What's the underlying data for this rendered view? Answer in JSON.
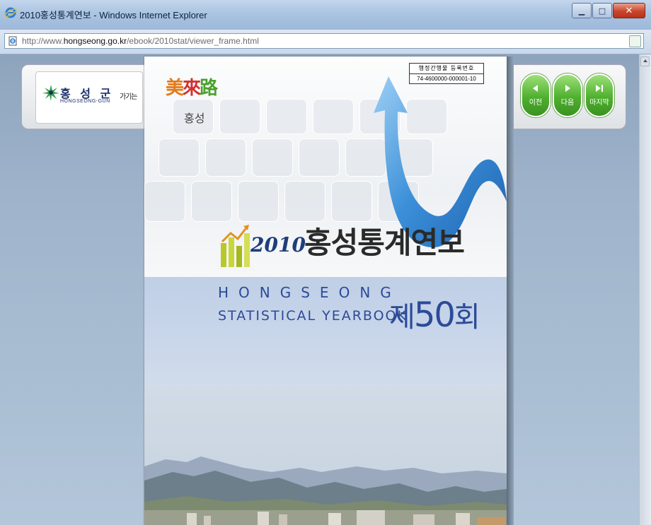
{
  "window": {
    "title": "2010홍성통계연보 - Windows Internet Explorer",
    "minimize_label": "▁",
    "maximize_label": "□",
    "close_label": "✕"
  },
  "address": {
    "url_prefix": "http://www.",
    "url_domain": "hongseong.go.kr",
    "url_path": "/ebook/2010stat/viewer_frame.html"
  },
  "logo": {
    "name": "홍 성 군",
    "sub": "HONGSEONG-GUN",
    "go_link": "가기는"
  },
  "nav": {
    "prev_label": "이전",
    "next_label": "다음",
    "last_label": "마지막"
  },
  "cover": {
    "slogan_chars": [
      "美",
      "來",
      "路"
    ],
    "slogan_sub": "홍성",
    "reg_title": "행정간행물 등록번호",
    "reg_number": "74-4600000-000001-10",
    "year": "2010",
    "title": "홍성통계연보",
    "en_line1": "HONGSEONG",
    "en_line2": "STATISTICAL YEARBOOK",
    "edition_prefix": "제",
    "edition_number": "50",
    "edition_suffix": "회"
  },
  "colors": {
    "accent_green": "#4fb02f",
    "title_blue": "#2c4a98",
    "arrow_blue": "#3b8fd8"
  }
}
